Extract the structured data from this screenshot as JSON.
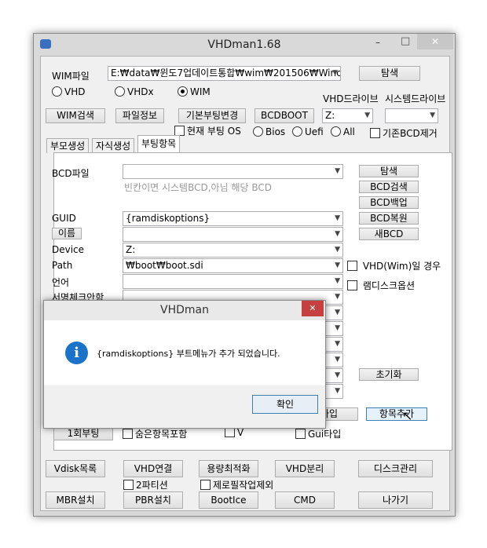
{
  "window": {
    "title": "VHDman1.68",
    "minimize": "–",
    "maximize": "□",
    "close": "✕"
  },
  "wim": {
    "label": "WIM파일",
    "path": "E:₩data₩윈도7업데이트통합₩wim₩201506₩Winc",
    "browse": "탐색"
  },
  "modes": [
    {
      "label": "VHD",
      "selected": false
    },
    {
      "label": "VHDx",
      "selected": false
    },
    {
      "label": "WIM",
      "selected": true
    }
  ],
  "drives": {
    "vhd_label": "VHD드라이브",
    "sys_label": "시스템드라이브",
    "vhd_value": "Z:",
    "sys_value": ""
  },
  "toolbar": {
    "wim_search": "WIM검색",
    "file_info": "파일정보",
    "default_boot": "기본부팅변경",
    "bcdboot": "BCDBOOT",
    "current_os": "현재 부팅 OS",
    "bios": "Bios",
    "uefi": "Uefi",
    "all": "All",
    "remove_bcd": "기존BCD제거"
  },
  "tabs": [
    "부모생성",
    "자식생성",
    "부팅항목"
  ],
  "boot": {
    "bcd_label": "BCD파일",
    "bcd_hint": "빈칸이면 시스템BCD,아님 해당 BCD",
    "guid_label": "GUID",
    "guid_value": "{ramdiskoptions}",
    "name_btn": "이름",
    "device_label": "Device",
    "device_value": "Z:",
    "path_label": "Path",
    "path_value": "₩boot₩boot.sdi",
    "lang_label": "언어",
    "sign_label": "서명체크안함",
    "buttons": {
      "browse": "탐색",
      "bcd_search": "BCD검색",
      "bcd_backup": "BCD백업",
      "bcd_restore": "BCD복원",
      "new_bcd": "새BCD",
      "reset": "초기화",
      "type": "타입",
      "add_item": "항목추가",
      "once_boot": "1회부팅"
    },
    "checks": {
      "vhd_wim": "VHD(Wim)일 경우",
      "ramdisk": "램디스크옵션",
      "hidden": "숨은항목포함",
      "v": "V",
      "gui": "Gui타입"
    }
  },
  "bottom": {
    "vdisk_list": "Vdisk목록",
    "vhd_attach": "VHD연결",
    "optimize": "용량최적화",
    "vhd_detach": "VHD분리",
    "disk_mgmt": "디스크관리",
    "two_part": "2파티션",
    "zero_fill": "제로필작업제외",
    "mbr": "MBR설치",
    "pbr": "PBR설치",
    "bootice": "BootIce",
    "cmd": "CMD",
    "exit": "나가기"
  },
  "dialog": {
    "title": "VHDman",
    "message": "{ramdiskoptions} 부트메뉴가 추가  되었습니다.",
    "ok": "확인",
    "close": "✕",
    "icon": "info-icon",
    "accent": "#1a73c8"
  }
}
